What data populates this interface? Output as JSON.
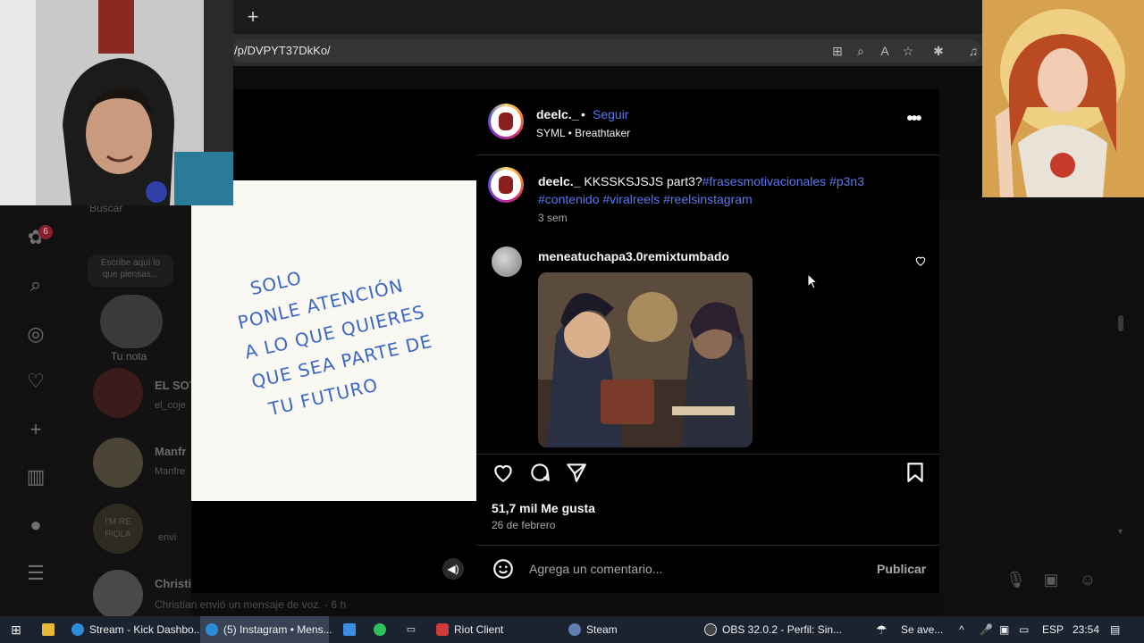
{
  "browser": {
    "url": "/p/DVPYT37DkKo/"
  },
  "instagram_bg": {
    "notifications_badge": "6",
    "search_placeholder": "Buscar",
    "note_placeholder": "Escribe aquí lo que piensas...",
    "note_label": "Tu nota",
    "conversations": [
      {
        "name": "EL SOT",
        "sub": "el_coje"
      },
      {
        "name": "Manfr",
        "sub": "Manfre"
      },
      {
        "name": "",
        "sub": "envi"
      },
      {
        "name": "Christi",
        "sub": ""
      }
    ],
    "bottom_message": "Christian envió un mensaje de voz. · 6 h",
    "avatar_text": "I'M RE PIOLA"
  },
  "post": {
    "username": "deelc._",
    "dot": "•",
    "follow_label": "Seguir",
    "audio": "SYML • Breathtaker",
    "caption_user": "deelc._",
    "caption_text": "KKSSKSJSJS part3?",
    "caption_tags": "#frasesmotivacionales #p3n3 #contenido #viralreels #reelsinstagram",
    "caption_time": "3 sem",
    "media_lines": [
      "SOLO",
      "PONLE ATENCIÓN",
      "A LO QUE QUIERES",
      "QUE SEA PARTE DE",
      "TU FUTURO"
    ],
    "comment_user": "meneatuchapa3.0remixtumbado",
    "likes": "51,7 mil Me gusta",
    "date": "26 de febrero",
    "comment_placeholder": "Agrega un comentario...",
    "publish_label": "Publicar"
  },
  "taskbar": {
    "items": [
      {
        "label": "Stream - Kick Dashbo..."
      },
      {
        "label": "(5) Instagram • Mens..."
      },
      {
        "label": "Riot Client"
      },
      {
        "label": "Steam"
      },
      {
        "label": "OBS 32.0.2 - Perfil: Sin..."
      }
    ],
    "weather": "Se ave...",
    "language": "ESP",
    "time": "23:54"
  },
  "colors": {
    "link_blue": "#5a78f0",
    "handwriting_blue": "#3a67c4",
    "taskbar": "#1b2230"
  }
}
